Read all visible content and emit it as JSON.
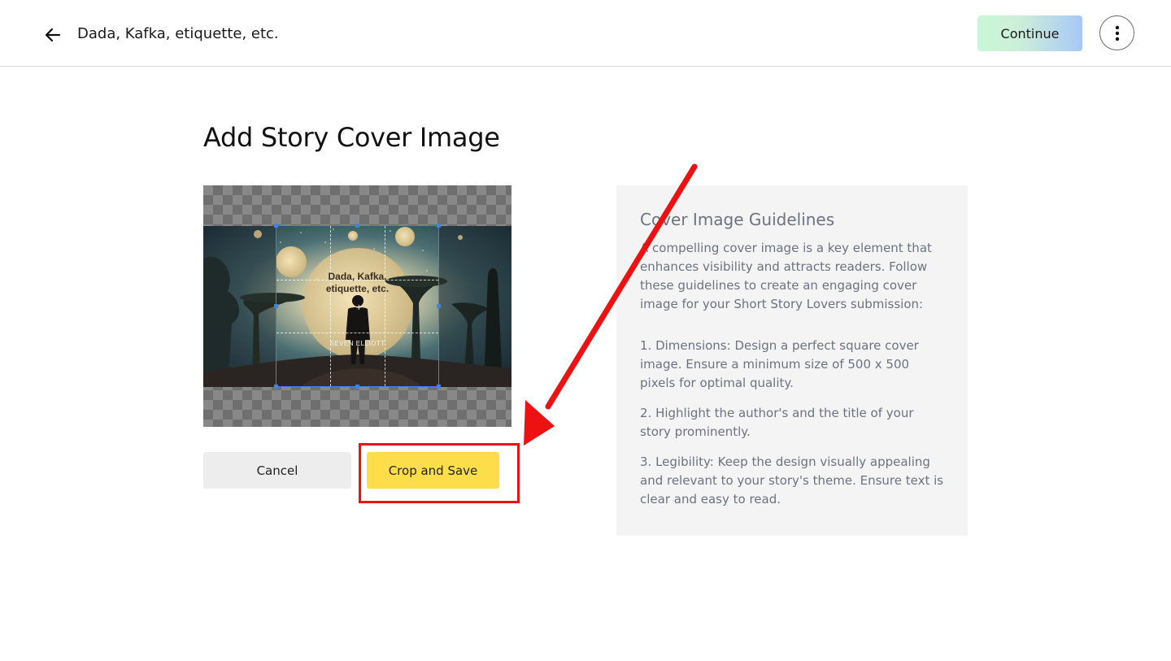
{
  "header": {
    "title": "Dada, Kafka, etiquette, etc.",
    "continue_label": "Continue"
  },
  "page": {
    "heading": "Add Story Cover Image"
  },
  "cover_image": {
    "title_line1": "Dada, Kafka,",
    "title_line2": "etiquette, etc.",
    "author": "SEVEN ELLIOTT"
  },
  "actions": {
    "cancel_label": "Cancel",
    "crop_save_label": "Crop and Save"
  },
  "guidelines": {
    "title": "Cover Image Guidelines",
    "intro": "A compelling cover image is a key element that enhances visibility and attracts readers. Follow these guidelines to create an engaging cover image for your Short Story Lovers submission:",
    "items": [
      "1. Dimensions: Design a perfect square cover image. Ensure a minimum size of 500 x 500 pixels for optimal quality.",
      "2. Highlight the author's and the title of your story prominently.",
      "3. Legibility: Keep the design visually appealing and relevant to your story's theme. Ensure text is clear and easy to read."
    ]
  },
  "colors": {
    "accent_yellow": "#fdde4a",
    "annotation_red": "#ee1111",
    "crop_blue": "#3b82f6"
  }
}
